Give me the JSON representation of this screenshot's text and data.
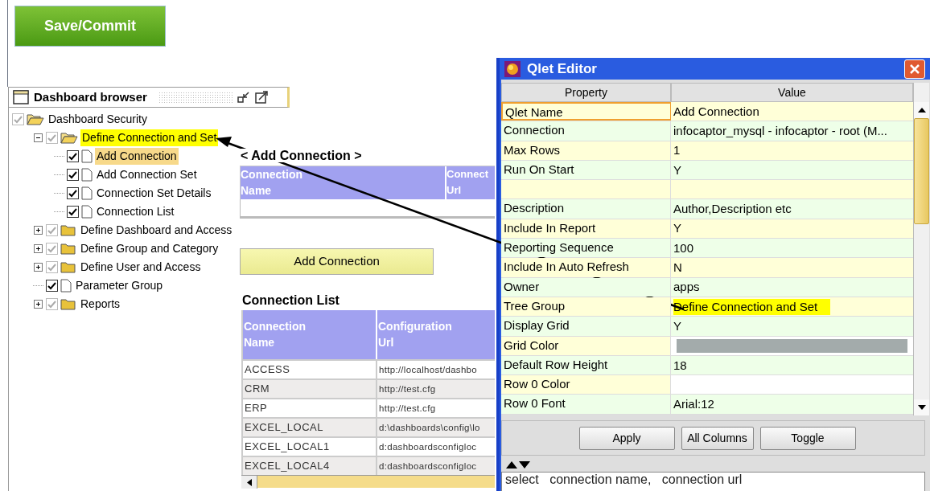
{
  "save_button": "Save/Commit",
  "browser": {
    "title": "Dashboard browser",
    "tree": [
      {
        "label": "Dashboard Security",
        "kind": "folder",
        "expanded": true,
        "checked": true,
        "selected": false,
        "highlighted": false,
        "children": [
          {
            "label": "Define Connection and Set",
            "kind": "folder",
            "expanded": true,
            "checked": true,
            "selected": false,
            "highlighted": true,
            "children": [
              {
                "label": "Add Connection",
                "kind": "document",
                "checked": true,
                "selected": true,
                "highlighted": false
              },
              {
                "label": "Add Connection Set",
                "kind": "document",
                "checked": true,
                "selected": false,
                "highlighted": false
              },
              {
                "label": "Connection Set Details",
                "kind": "document",
                "checked": true,
                "selected": false,
                "highlighted": false
              },
              {
                "label": "Connection List",
                "kind": "document",
                "checked": true,
                "selected": false,
                "highlighted": false
              }
            ]
          },
          {
            "label": "Define Dashboard and Access",
            "kind": "folder",
            "expanded": false,
            "checked": true,
            "selected": false,
            "highlighted": false
          },
          {
            "label": "Define Group and Category",
            "kind": "folder",
            "expanded": false,
            "checked": true,
            "selected": false,
            "highlighted": false
          },
          {
            "label": "Define User and Access",
            "kind": "folder",
            "expanded": false,
            "checked": true,
            "selected": false,
            "highlighted": false
          },
          {
            "label": "Parameter Group",
            "kind": "document",
            "checked": true,
            "selected": false,
            "highlighted": false
          },
          {
            "label": "Reports",
            "kind": "folder",
            "expanded": false,
            "checked": true,
            "selected": false,
            "highlighted": false
          }
        ]
      }
    ]
  },
  "form": {
    "title": "< Add Connection >",
    "columns": [
      "Connection\nName",
      "Connect\nUrl"
    ],
    "button": "Add Connection"
  },
  "list": {
    "title": "Connection List",
    "columns": [
      "Connection\nName",
      "Configuration\nUrl"
    ],
    "rows": [
      [
        "ACCESS",
        "http://localhost/dashbo"
      ],
      [
        "CRM",
        "http://test.cfg"
      ],
      [
        "ERP",
        "http://test.cfg"
      ],
      [
        "EXCEL_LOCAL",
        "d:\\dashboards\\config\\lo"
      ],
      [
        "EXCEL_LOCAL1",
        "d:dashboardsconfigloc"
      ],
      [
        "EXCEL_LOCAL4",
        "d:dashboardsconfigloc"
      ]
    ]
  },
  "editor": {
    "title": "Qlet Editor",
    "columns": [
      "Property",
      "Value"
    ],
    "rows": [
      {
        "kind": "text",
        "property": "Qlet Name",
        "value": "Add Connection",
        "focused": true,
        "highlighted": false
      },
      {
        "kind": "text",
        "property": "Connection",
        "value": "infocaptor_mysql - infocaptor - root (M...",
        "focused": false,
        "highlighted": false
      },
      {
        "kind": "text",
        "property": "Max Rows",
        "value": "1",
        "focused": false,
        "highlighted": false
      },
      {
        "kind": "text",
        "property": "Run On Start",
        "value": "Y",
        "focused": false,
        "highlighted": false
      },
      {
        "kind": "blank",
        "focused": false,
        "highlighted": false
      },
      {
        "kind": "text",
        "property": "Description",
        "value": "Author,Description etc",
        "focused": false,
        "highlighted": false
      },
      {
        "kind": "text",
        "property": "Include In Report",
        "value": "Y",
        "focused": false,
        "highlighted": false
      },
      {
        "kind": "text",
        "property": "Reporting Sequence",
        "value": "100",
        "focused": false,
        "highlighted": false
      },
      {
        "kind": "text",
        "property": "Include In Auto Refresh",
        "value": "N",
        "focused": false,
        "highlighted": false
      },
      {
        "kind": "text",
        "property": "Owner",
        "value": "apps",
        "focused": false,
        "highlighted": false
      },
      {
        "kind": "text",
        "property": "Tree Group",
        "value": "Define Connection and Set",
        "focused": false,
        "highlighted": true
      },
      {
        "kind": "text",
        "property": "Display Grid",
        "value": "Y",
        "focused": false,
        "highlighted": false
      },
      {
        "kind": "swatch",
        "property": "Grid Color",
        "color": "#a3abab",
        "focused": false,
        "highlighted": false
      },
      {
        "kind": "text",
        "property": "Default Row Height",
        "value": "18",
        "focused": false,
        "highlighted": false
      },
      {
        "kind": "empty",
        "property": "Row 0 Color",
        "focused": false,
        "highlighted": false
      },
      {
        "kind": "text",
        "property": "Row 0 Font",
        "value": "Arial:12",
        "focused": false,
        "highlighted": false
      }
    ],
    "buttons": [
      "Apply",
      "All Columns",
      "Toggle"
    ],
    "query": "select   connection name,   connection url"
  }
}
